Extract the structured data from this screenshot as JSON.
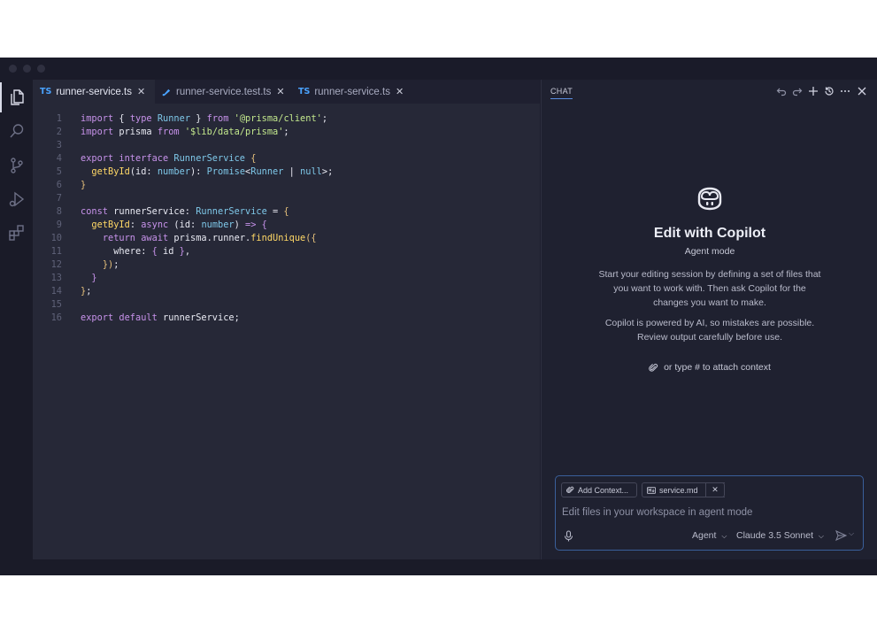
{
  "editor": {
    "tabs": [
      {
        "badge": "TS",
        "label": "runner-service.ts",
        "close": "✕"
      },
      {
        "badge": "",
        "label": "runner-service.test.ts",
        "close": "✕"
      },
      {
        "badge": "TS",
        "label": "runner-service.ts",
        "close": "✕"
      }
    ],
    "line_numbers": [
      "1",
      "2",
      "3",
      "4",
      "5",
      "6",
      "7",
      "8",
      "9",
      "10",
      "11",
      "12",
      "13",
      "14",
      "15",
      "16"
    ]
  },
  "chat": {
    "tab_label": "CHAT",
    "heading": "Edit with Copilot",
    "mode": "Agent mode",
    "intro": "Start your editing session by defining a set of files that you want to work with. Then ask Copilot for the changes you want to make.",
    "disclaimer": "Copilot is powered by AI, so mistakes are possible. Review output carefully before use.",
    "attach_hint": "or type # to attach context",
    "add_context": "Add Context...",
    "file_chip": "service.md",
    "chip_close": "✕",
    "input_placeholder": "Edit files in your workspace in agent mode",
    "agent_select": "Agent",
    "model_select": "Claude 3.5 Sonnet",
    "header_icons": [
      "undo-icon",
      "redo-icon",
      "plus-icon",
      "history-icon",
      "more-icon",
      "close-icon"
    ]
  },
  "colors": {
    "editor_bg": "#262837",
    "chat_bg": "#1f2130",
    "accent": "#4aa3ff",
    "keyword": "#c792ea",
    "type": "#7ec7e8",
    "string": "#c3e88d",
    "function": "#ffd866"
  }
}
